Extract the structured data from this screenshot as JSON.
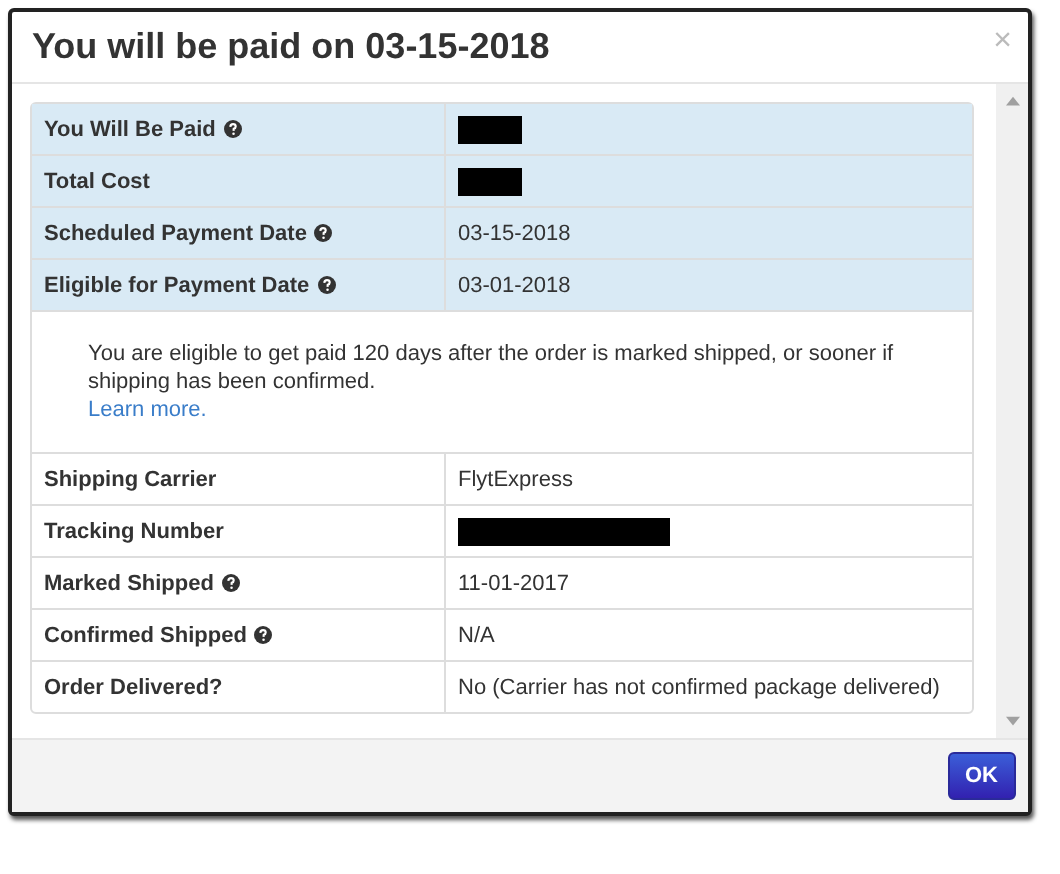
{
  "dialog": {
    "title": "You will be paid on 03-15-2018",
    "close": "×"
  },
  "payment_rows": [
    {
      "kind": "redacted",
      "label": "You Will Be Paid",
      "help": true,
      "highlighted": true
    },
    {
      "kind": "redacted",
      "label": "Total Cost",
      "help": false,
      "highlighted": true
    },
    {
      "kind": "text",
      "label": "Scheduled Payment Date",
      "help": true,
      "highlighted": true,
      "value": "03-15-2018"
    },
    {
      "kind": "text",
      "label": "Eligible for Payment Date",
      "help": true,
      "highlighted": true,
      "value": "03-01-2018"
    }
  ],
  "info": {
    "text": "You are eligible to get paid 120 days after the order is marked shipped, or sooner if shipping has been confirmed.",
    "link": "Learn more."
  },
  "shipping_rows": [
    {
      "kind": "text",
      "label": "Shipping Carrier",
      "help": false,
      "highlighted": false,
      "value": "FlytExpress"
    },
    {
      "kind": "redactedwide",
      "label": "Tracking Number",
      "help": false,
      "highlighted": false
    },
    {
      "kind": "text",
      "label": "Marked Shipped",
      "help": true,
      "highlighted": false,
      "value": "11-01-2017"
    },
    {
      "kind": "text",
      "label": "Confirmed Shipped",
      "help": true,
      "highlighted": false,
      "value": "N/A"
    },
    {
      "kind": "text",
      "label": "Order Delivered?",
      "help": false,
      "highlighted": false,
      "value": "No (Carrier has not confirmed package delivered)"
    }
  ],
  "buttons": [
    "OK"
  ]
}
